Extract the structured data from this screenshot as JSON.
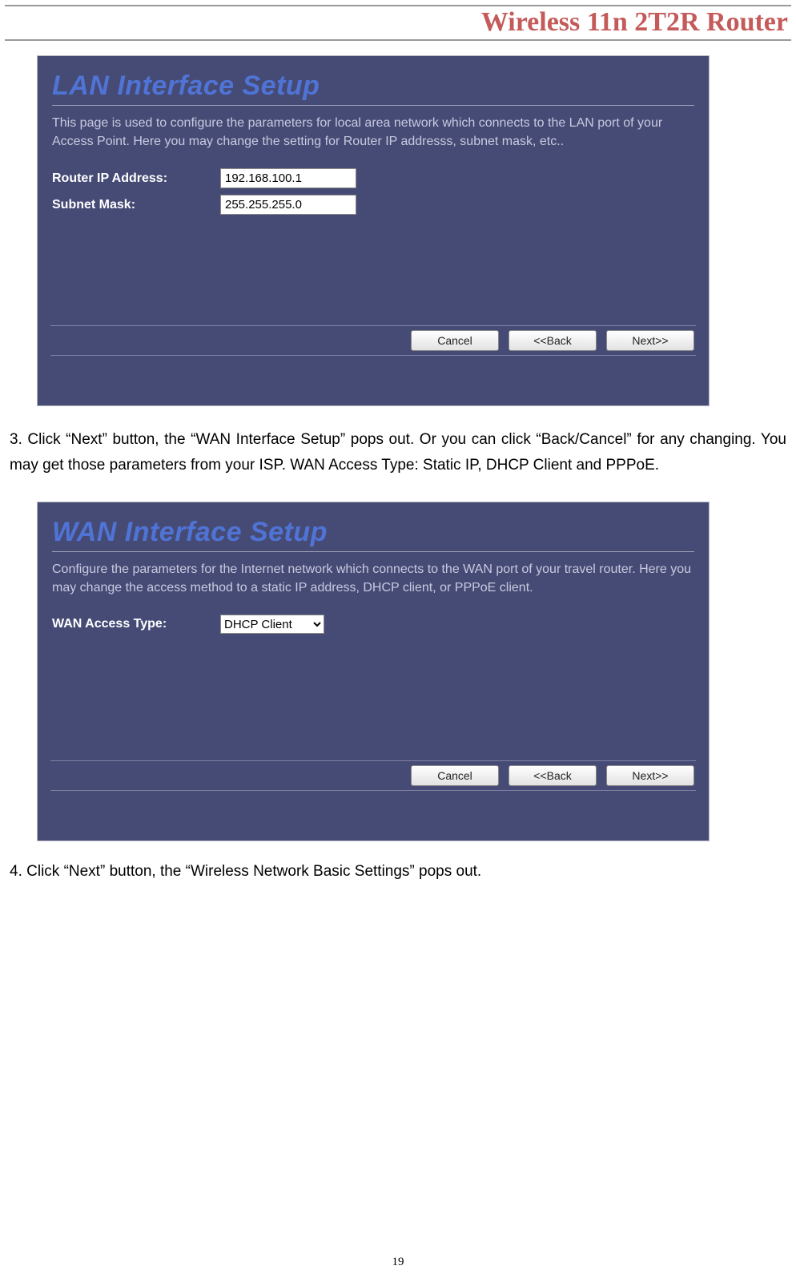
{
  "header_title": "Wireless 11n 2T2R Router",
  "lan_panel": {
    "title": "LAN Interface Setup",
    "desc": "This page is used to configure the parameters for local area network which connects to the LAN port of your Access Point. Here you may change the setting for Router IP addresss, subnet mask, etc..",
    "ip_label": "Router IP Address:",
    "ip_value": "192.168.100.1",
    "mask_label": "Subnet Mask:",
    "mask_value": "255.255.255.0",
    "cancel": "Cancel",
    "back": "<<Back",
    "next": "Next>>"
  },
  "step3_text": "3. Click “Next” button, the “WAN Interface Setup” pops out. Or you can click “Back/Cancel” for any changing. You may get those parameters from your ISP. WAN Access Type: Static IP, DHCP Client and PPPoE.",
  "wan_panel": {
    "title": "WAN Interface Setup",
    "desc": "Configure the parameters for the Internet network which connects to the WAN port of your travel router. Here you may change the access method to a static IP address, DHCP client, or PPPoE client.",
    "type_label": "WAN Access Type:",
    "type_value": "DHCP Client",
    "cancel": "Cancel",
    "back": "<<Back",
    "next": "Next>>"
  },
  "step4_text": "4. Click “Next” button, the “Wireless Network Basic Settings” pops out.",
  "page_number": "19"
}
